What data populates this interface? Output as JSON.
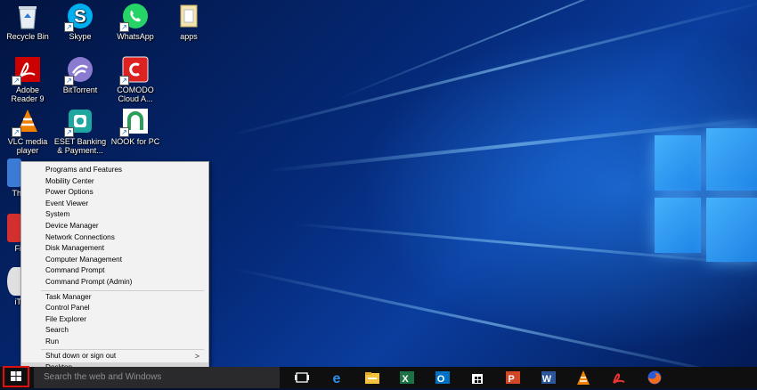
{
  "desktop_icons": [
    {
      "label": "Recycle Bin",
      "icon": "recycle-bin-icon"
    },
    {
      "label": "Skype",
      "icon": "skype-icon"
    },
    {
      "label": "WhatsApp",
      "icon": "whatsapp-icon"
    },
    {
      "label": "apps",
      "icon": "folder-icon"
    },
    {
      "label": "Adobe\nReader 9",
      "icon": "adobe-reader-icon"
    },
    {
      "label": "BitTorrent",
      "icon": "bittorrent-icon"
    },
    {
      "label": "COMODO\nCloud A...",
      "icon": "comodo-icon"
    },
    {
      "label": "VLC media\nplayer",
      "icon": "vlc-icon"
    },
    {
      "label": "ESET Banking\n& Payment...",
      "icon": "eset-icon"
    },
    {
      "label": "NOOK for PC",
      "icon": "nook-icon"
    },
    {
      "label": "Th",
      "icon": "partial-icon"
    },
    {
      "label": "Fi",
      "icon": "partial-icon"
    },
    {
      "label": "iT",
      "icon": "partial-icon"
    }
  ],
  "context_menu": {
    "group1": [
      "Programs and Features",
      "Mobility Center",
      "Power Options",
      "Event Viewer",
      "System",
      "Device Manager",
      "Network Connections",
      "Disk Management",
      "Computer Management",
      "Command Prompt",
      "Command Prompt (Admin)"
    ],
    "group2": [
      "Task Manager",
      "Control Panel",
      "File Explorer",
      "Search",
      "Run"
    ],
    "shutdown": "Shut down or sign out",
    "desktop": "Desktop"
  },
  "taskbar": {
    "search_placeholder": "Search the web and Windows",
    "pinned": [
      "task-view-icon",
      "edge-icon",
      "file-explorer-icon",
      "excel-icon",
      "outlook-icon",
      "store-icon",
      "powerpoint-icon",
      "word-icon",
      "vlc-icon",
      "adobe-reader-icon",
      "firefox-icon"
    ]
  },
  "colors": {
    "highlight": "#e01010",
    "menu_bg": "#f2f2f2",
    "taskbar_bg": "#0f0f10"
  }
}
